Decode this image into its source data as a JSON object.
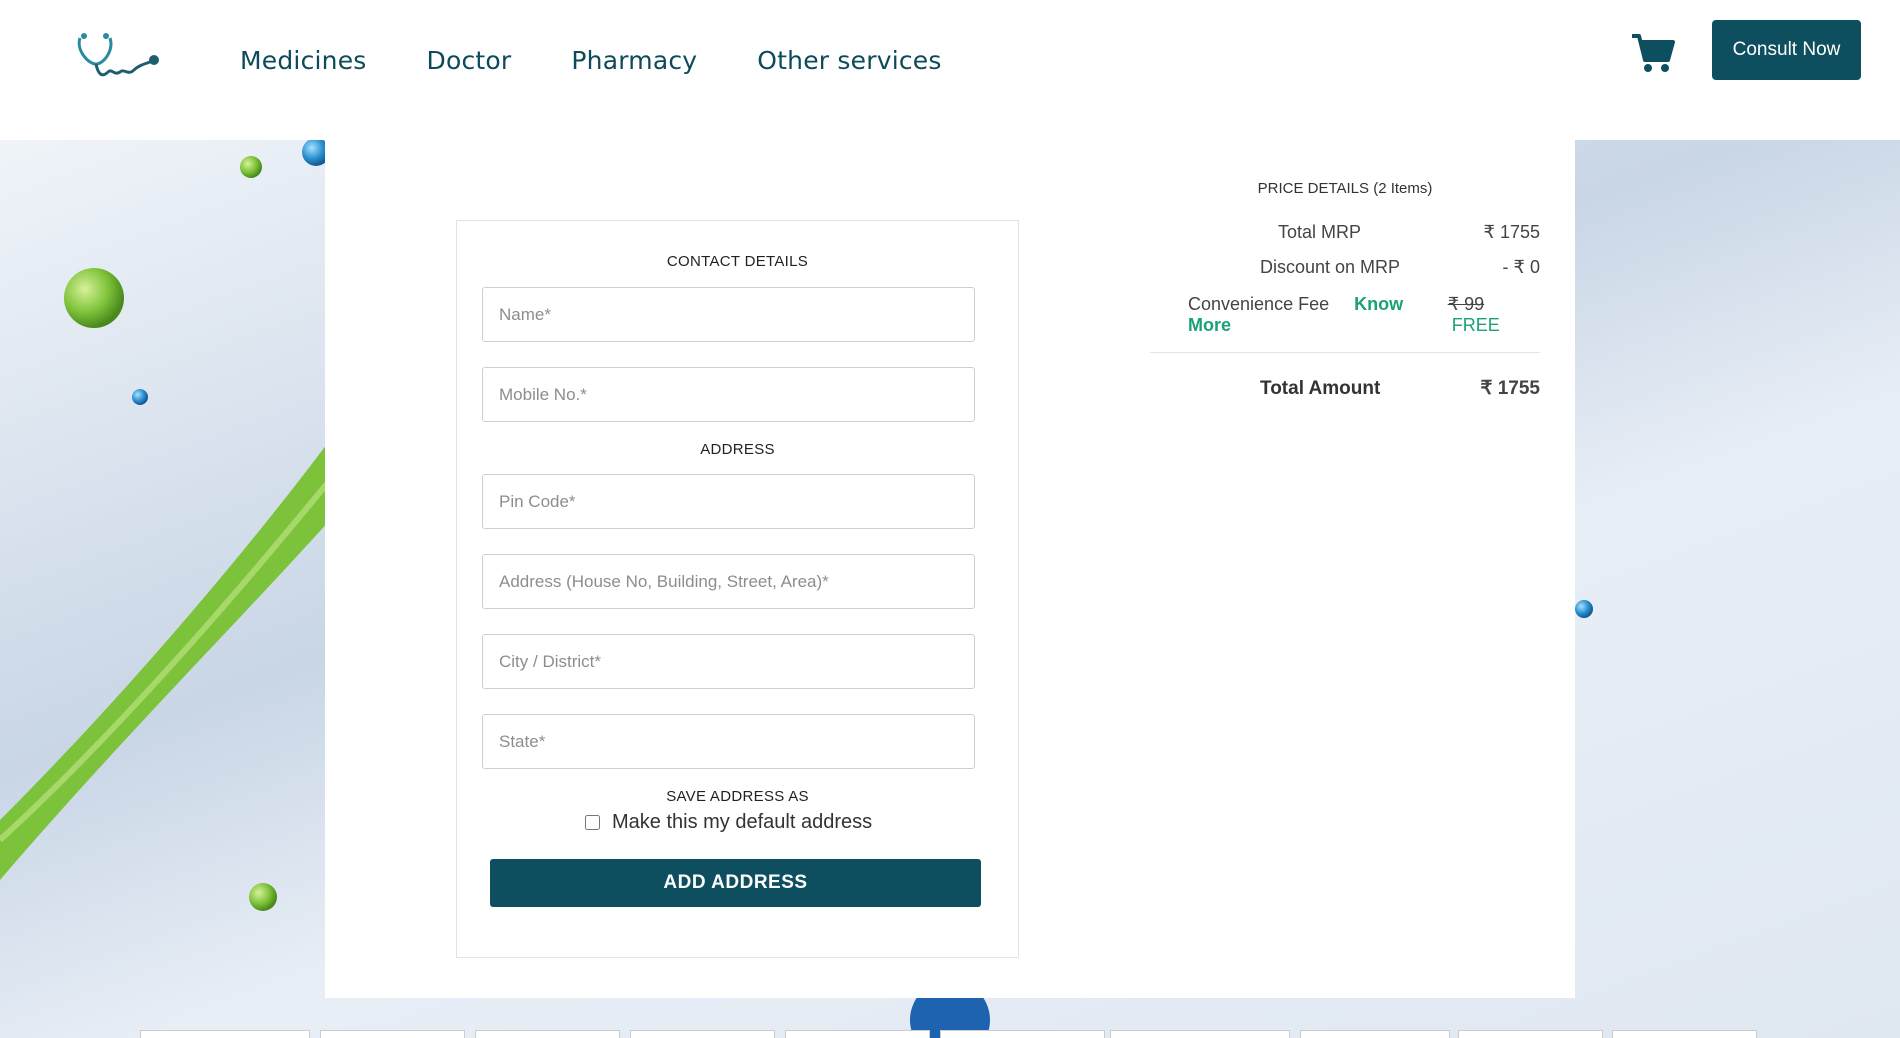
{
  "header": {
    "nav": [
      "Medicines",
      "Doctor",
      "Pharmacy",
      "Other services"
    ],
    "consult_label": "Consult Now"
  },
  "form": {
    "contact_title": "CONTACT DETAILS",
    "name_placeholder": "Name*",
    "mobile_placeholder": "Mobile No.*",
    "address_title": "ADDRESS",
    "pincode_placeholder": "Pin Code*",
    "address_placeholder": "Address (House No, Building, Street, Area)*",
    "city_placeholder": "City / District*",
    "state_placeholder": "State*",
    "save_as_title": "SAVE ADDRESS AS",
    "default_label": "Make this my default address",
    "add_button": "ADD ADDRESS"
  },
  "price": {
    "title": "PRICE DETAILS (2 Items)",
    "total_mrp_label": "Total MRP",
    "total_mrp_value": "₹ 1755",
    "discount_label": "Discount on MRP",
    "discount_value": "- ₹ 0",
    "convenience_label": "Convenience Fee",
    "know_more": "Know More",
    "convenience_old": "₹ 99",
    "convenience_new": "FREE",
    "total_label": "Total Amount",
    "total_value": "₹ 1755"
  },
  "colors": {
    "brand": "#0d4f5e",
    "accent_green": "#1aa07a"
  }
}
